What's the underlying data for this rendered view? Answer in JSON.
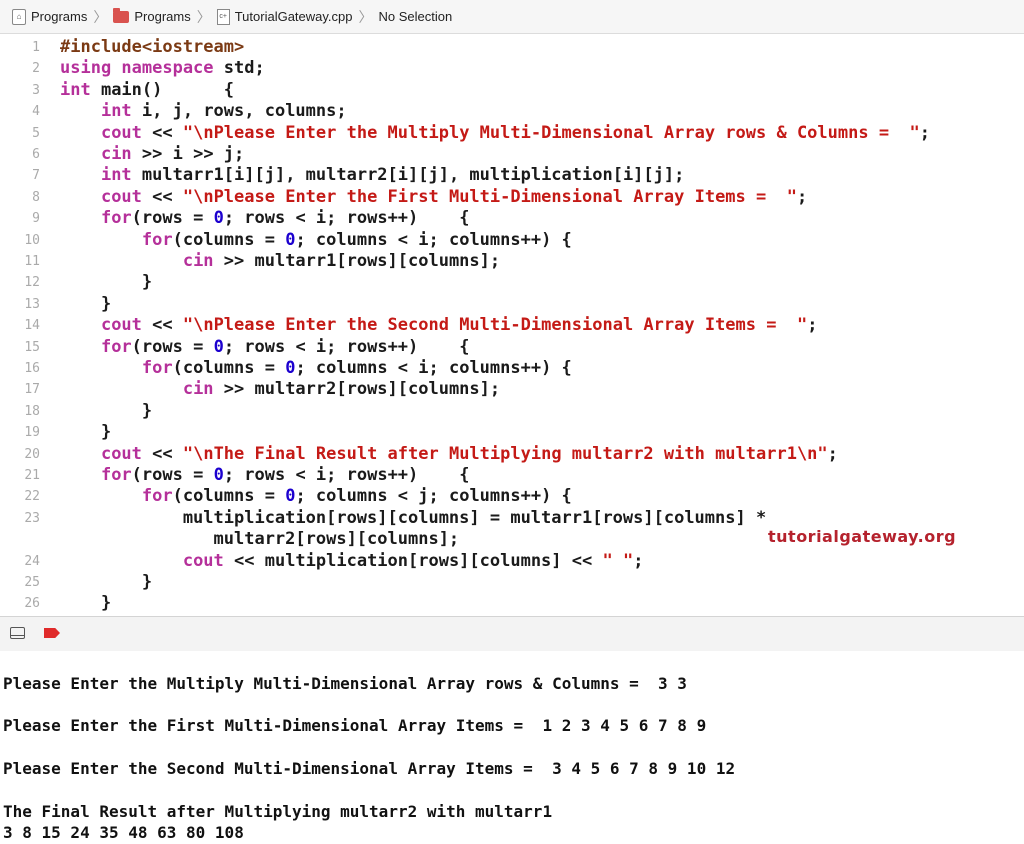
{
  "breadcrumb": {
    "items": [
      "Programs",
      "Programs",
      "TutorialGateway.cpp",
      "No Selection"
    ]
  },
  "editor": {
    "lines": [
      {
        "n": "1",
        "segs": [
          {
            "t": "#include<iostream>",
            "c": "pp"
          }
        ]
      },
      {
        "n": "2",
        "segs": [
          {
            "t": "using namespace",
            "c": "kw"
          },
          {
            "t": " std;",
            "c": ""
          }
        ]
      },
      {
        "n": "3",
        "segs": [
          {
            "t": "int",
            "c": "kw"
          },
          {
            "t": " main()      {",
            "c": ""
          }
        ]
      },
      {
        "n": "4",
        "segs": [
          {
            "t": "    ",
            "c": ""
          },
          {
            "t": "int",
            "c": "kw"
          },
          {
            "t": " i, j, rows, columns;",
            "c": ""
          }
        ]
      },
      {
        "n": "5",
        "segs": [
          {
            "t": "    ",
            "c": ""
          },
          {
            "t": "cout",
            "c": "kw"
          },
          {
            "t": " << ",
            "c": ""
          },
          {
            "t": "\"\\nPlease Enter the Multiply Multi-Dimensional Array rows & Columns =  \"",
            "c": "str"
          },
          {
            "t": ";",
            "c": ""
          }
        ]
      },
      {
        "n": "6",
        "segs": [
          {
            "t": "    ",
            "c": ""
          },
          {
            "t": "cin",
            "c": "kw"
          },
          {
            "t": " >> i >> j;",
            "c": ""
          }
        ]
      },
      {
        "n": "7",
        "segs": [
          {
            "t": "    ",
            "c": ""
          },
          {
            "t": "int",
            "c": "kw"
          },
          {
            "t": " multarr1[i][j], multarr2[i][j], multiplication[i][j];",
            "c": ""
          }
        ]
      },
      {
        "n": "8",
        "segs": [
          {
            "t": "    ",
            "c": ""
          },
          {
            "t": "cout",
            "c": "kw"
          },
          {
            "t": " << ",
            "c": ""
          },
          {
            "t": "\"\\nPlease Enter the First Multi-Dimensional Array Items =  \"",
            "c": "str"
          },
          {
            "t": ";",
            "c": ""
          }
        ]
      },
      {
        "n": "9",
        "segs": [
          {
            "t": "    ",
            "c": ""
          },
          {
            "t": "for",
            "c": "kw"
          },
          {
            "t": "(rows = ",
            "c": ""
          },
          {
            "t": "0",
            "c": "num"
          },
          {
            "t": "; rows < i; rows++)    {",
            "c": ""
          }
        ]
      },
      {
        "n": "10",
        "segs": [
          {
            "t": "        ",
            "c": ""
          },
          {
            "t": "for",
            "c": "kw"
          },
          {
            "t": "(columns = ",
            "c": ""
          },
          {
            "t": "0",
            "c": "num"
          },
          {
            "t": "; columns < i; columns++) {",
            "c": ""
          }
        ]
      },
      {
        "n": "11",
        "segs": [
          {
            "t": "            ",
            "c": ""
          },
          {
            "t": "cin",
            "c": "kw"
          },
          {
            "t": " >> multarr1[rows][columns];",
            "c": ""
          }
        ]
      },
      {
        "n": "12",
        "segs": [
          {
            "t": "        }",
            "c": ""
          }
        ]
      },
      {
        "n": "13",
        "segs": [
          {
            "t": "    }",
            "c": ""
          }
        ]
      },
      {
        "n": "14",
        "segs": [
          {
            "t": "    ",
            "c": ""
          },
          {
            "t": "cout",
            "c": "kw"
          },
          {
            "t": " << ",
            "c": ""
          },
          {
            "t": "\"\\nPlease Enter the Second Multi-Dimensional Array Items =  \"",
            "c": "str"
          },
          {
            "t": ";",
            "c": ""
          }
        ]
      },
      {
        "n": "15",
        "segs": [
          {
            "t": "    ",
            "c": ""
          },
          {
            "t": "for",
            "c": "kw"
          },
          {
            "t": "(rows = ",
            "c": ""
          },
          {
            "t": "0",
            "c": "num"
          },
          {
            "t": "; rows < i; rows++)    {",
            "c": ""
          }
        ]
      },
      {
        "n": "16",
        "segs": [
          {
            "t": "        ",
            "c": ""
          },
          {
            "t": "for",
            "c": "kw"
          },
          {
            "t": "(columns = ",
            "c": ""
          },
          {
            "t": "0",
            "c": "num"
          },
          {
            "t": "; columns < i; columns++) {",
            "c": ""
          }
        ]
      },
      {
        "n": "17",
        "segs": [
          {
            "t": "            ",
            "c": ""
          },
          {
            "t": "cin",
            "c": "kw"
          },
          {
            "t": " >> multarr2[rows][columns];",
            "c": ""
          }
        ]
      },
      {
        "n": "18",
        "segs": [
          {
            "t": "        }",
            "c": ""
          }
        ]
      },
      {
        "n": "19",
        "segs": [
          {
            "t": "    }",
            "c": ""
          }
        ]
      },
      {
        "n": "20",
        "segs": [
          {
            "t": "    ",
            "c": ""
          },
          {
            "t": "cout",
            "c": "kw"
          },
          {
            "t": " << ",
            "c": ""
          },
          {
            "t": "\"\\nThe Final Result after Multiplying multarr2 with multarr1\\n\"",
            "c": "str"
          },
          {
            "t": ";",
            "c": ""
          }
        ]
      },
      {
        "n": "21",
        "segs": [
          {
            "t": "    ",
            "c": ""
          },
          {
            "t": "for",
            "c": "kw"
          },
          {
            "t": "(rows = ",
            "c": ""
          },
          {
            "t": "0",
            "c": "num"
          },
          {
            "t": "; rows < i; rows++)    {",
            "c": ""
          }
        ]
      },
      {
        "n": "22",
        "segs": [
          {
            "t": "        ",
            "c": ""
          },
          {
            "t": "for",
            "c": "kw"
          },
          {
            "t": "(columns = ",
            "c": ""
          },
          {
            "t": "0",
            "c": "num"
          },
          {
            "t": "; columns < j; columns++) {",
            "c": ""
          }
        ]
      },
      {
        "n": "23",
        "segs": [
          {
            "t": "            multiplication[rows][columns] = multarr1[rows][columns] *",
            "c": ""
          }
        ]
      },
      {
        "n": "",
        "segs": [
          {
            "t": "               multarr2[rows][columns];",
            "c": ""
          }
        ]
      },
      {
        "n": "24",
        "segs": [
          {
            "t": "            ",
            "c": ""
          },
          {
            "t": "cout",
            "c": "kw"
          },
          {
            "t": " << multiplication[rows][columns] << ",
            "c": ""
          },
          {
            "t": "\" \"",
            "c": "str"
          },
          {
            "t": ";",
            "c": ""
          }
        ]
      },
      {
        "n": "25",
        "segs": [
          {
            "t": "        }",
            "c": ""
          }
        ]
      },
      {
        "n": "26",
        "segs": [
          {
            "t": "    }",
            "c": ""
          }
        ]
      }
    ]
  },
  "watermark": "tutorialgateway.org",
  "console": {
    "lines": [
      "Please Enter the Multiply Multi-Dimensional Array rows & Columns =  3 3",
      "Please Enter the First Multi-Dimensional Array Items =  1 2 3 4 5 6 7 8 9",
      "Please Enter the Second Multi-Dimensional Array Items =  3 4 5 6 7 8 9 10 12",
      "The Final Result after Multiplying multarr2 with multarr1",
      "3 8 15 24 35 48 63 80 108"
    ]
  },
  "colors": {
    "keyword": "#b5309a",
    "string": "#c41a16",
    "preprocessor": "#7b3a14",
    "number": "#1c00cf",
    "breakpoint": "#e02a2a"
  },
  "icons": [
    "project-icon",
    "folder-icon",
    "cpp-file-icon",
    "hide-debug-area-icon",
    "breakpoint-icon"
  ]
}
